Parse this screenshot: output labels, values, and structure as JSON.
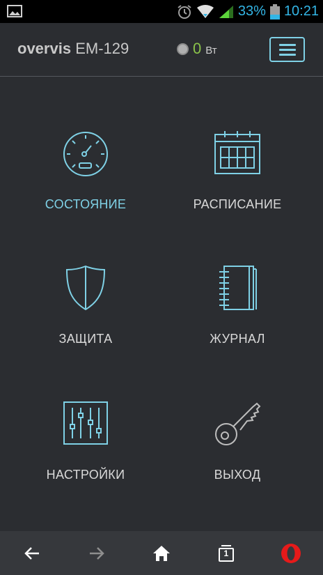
{
  "status_bar": {
    "battery": "33%",
    "time": "10:21",
    "icons": [
      "image-icon",
      "alarm-icon",
      "wifi-icon",
      "signal-icon",
      "battery-icon"
    ]
  },
  "header": {
    "brand_name": "overvis",
    "device_model": "EM-129",
    "power_value": "0",
    "power_unit": "Вт",
    "menu_icon": "hamburger-icon"
  },
  "menu": {
    "items": [
      {
        "label": "СОСТОЯНИЕ",
        "icon": "gauge-icon",
        "active": true
      },
      {
        "label": "РАСПИСАНИЕ",
        "icon": "calendar-icon",
        "active": false
      },
      {
        "label": "ЗАЩИТА",
        "icon": "shield-icon",
        "active": false
      },
      {
        "label": "ЖУРНАЛ",
        "icon": "journal-icon",
        "active": false
      },
      {
        "label": "НАСТРОЙКИ",
        "icon": "sliders-icon",
        "active": false
      },
      {
        "label": "ВЫХОД",
        "icon": "key-icon",
        "active": false
      }
    ]
  },
  "browser_nav": {
    "tabs_count": "1",
    "icons": [
      "back-arrow-icon",
      "forward-arrow-icon",
      "home-icon",
      "tabs-icon",
      "opera-icon"
    ]
  },
  "colors": {
    "background": "#2b2d31",
    "accent": "#7fd1e6",
    "power_value": "#8bc34a",
    "status_text": "#33b5e5"
  }
}
